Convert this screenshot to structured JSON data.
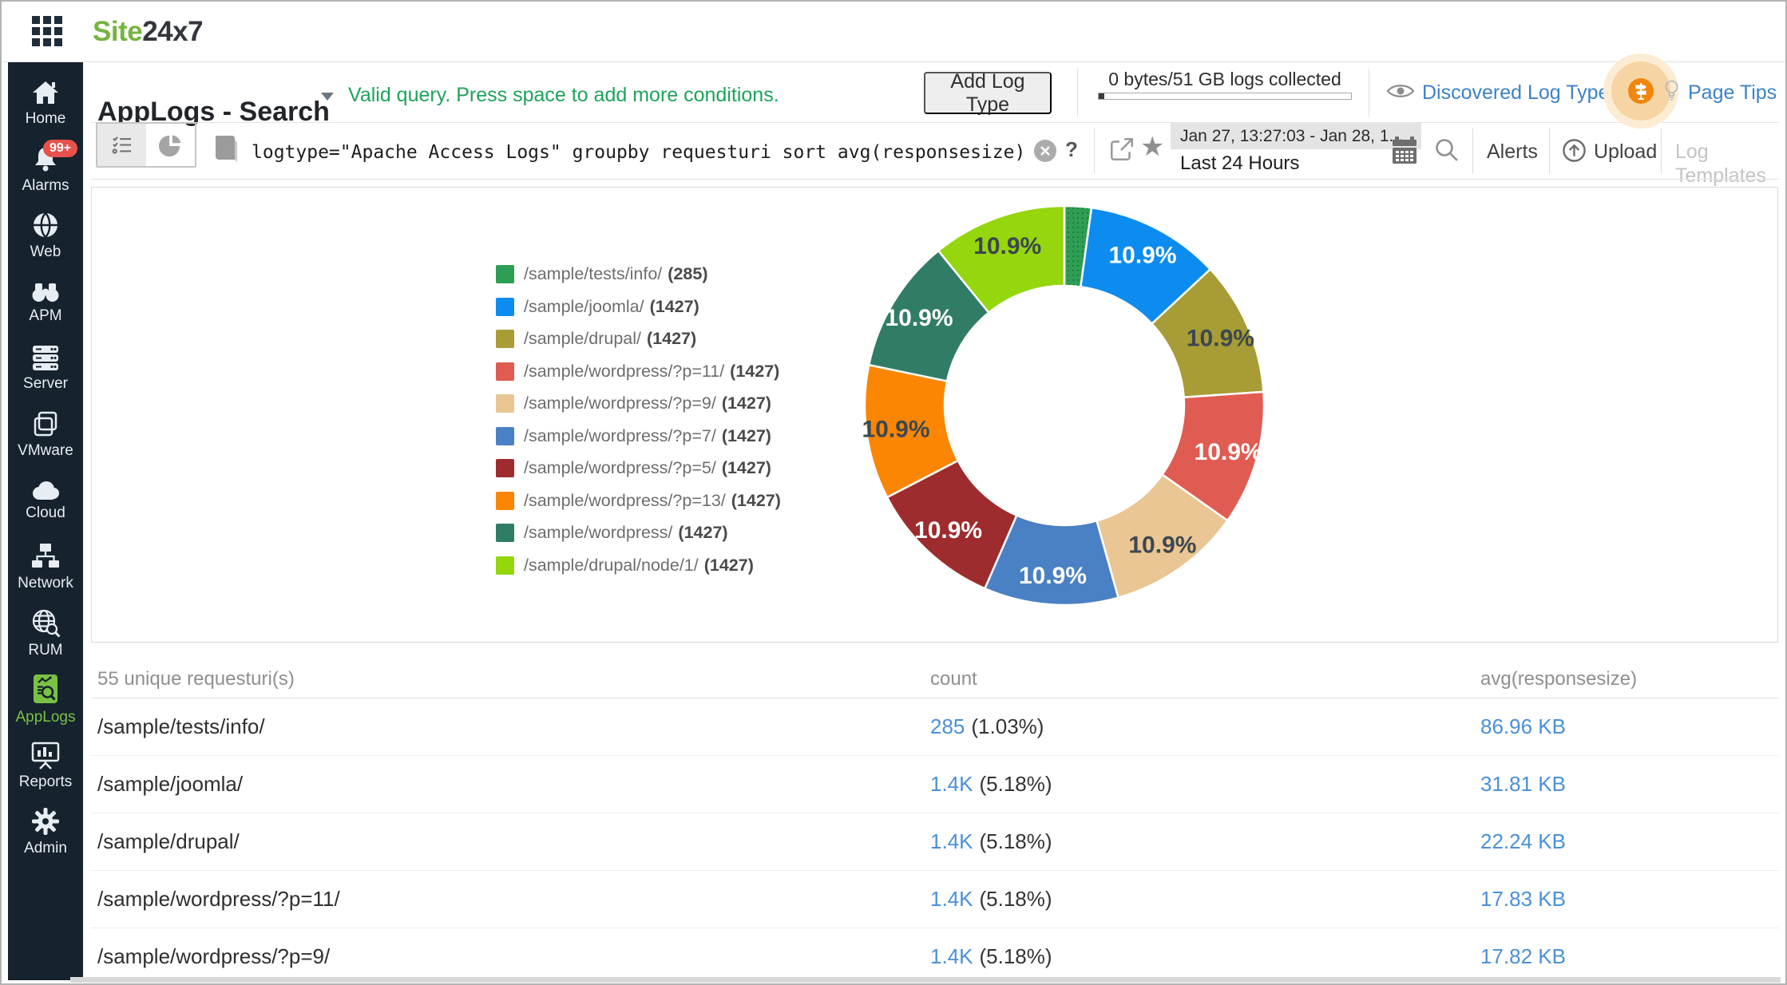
{
  "topbar": {
    "logo_prefix": "Site",
    "logo_suffix": "24x7"
  },
  "sidebar": {
    "items": [
      {
        "label": "Home",
        "icon": "home-icon"
      },
      {
        "label": "Alarms",
        "icon": "bell-icon",
        "badge": "99+"
      },
      {
        "label": "Web",
        "icon": "globe-icon"
      },
      {
        "label": "APM",
        "icon": "binoculars-icon"
      },
      {
        "label": "Server",
        "icon": "server-icon"
      },
      {
        "label": "VMware",
        "icon": "vmware-layers-icon"
      },
      {
        "label": "Cloud",
        "icon": "cloud-icon"
      },
      {
        "label": "Network",
        "icon": "network-icon"
      },
      {
        "label": "RUM",
        "icon": "rum-globe-search-icon"
      },
      {
        "label": "AppLogs",
        "icon": "applogs-icon",
        "active": true
      },
      {
        "label": "Reports",
        "icon": "reports-icon"
      },
      {
        "label": "Admin",
        "icon": "gear-icon"
      }
    ]
  },
  "header": {
    "title": "AppLogs - Search",
    "validation": "Valid query. Press space to add more conditions.",
    "add_log_type": "Add Log Type",
    "quota": "0 bytes/51 GB logs collected",
    "discovered_log_types": "Discovered Log Types",
    "page_tips": "Page Tips"
  },
  "querybar": {
    "query": "logtype=\"Apache Access Logs\" groupby requesturi sort avg(responsesize)",
    "help": "?",
    "star": "★",
    "date_range": "Jan 27, 13:27:03 - Jan 28, 1...",
    "date_preset": "Last 24 Hours",
    "alerts": "Alerts",
    "upload": "Upload",
    "log_templates": "Log Templates"
  },
  "chart_data": {
    "type": "pie",
    "style": "donut",
    "title": "",
    "legend_position": "left",
    "start_angle_deg": -90,
    "direction": "clockwise",
    "labels": [
      "/sample/tests/info/",
      "/sample/joomla/",
      "/sample/drupal/",
      "/sample/wordpress/?p=11/",
      "/sample/wordpress/?p=9/",
      "/sample/wordpress/?p=7/",
      "/sample/wordpress/?p=5/",
      "/sample/wordpress/?p=13/",
      "/sample/wordpress/",
      "/sample/drupal/node/1/"
    ],
    "values": [
      285,
      1427,
      1427,
      1427,
      1427,
      1427,
      1427,
      1427,
      1427,
      1427
    ],
    "colors": [
      "#2f9e55",
      "#0d8cf0",
      "#a79c35",
      "#e05b52",
      "#e9c693",
      "#4a80c4",
      "#9e2b2d",
      "#fb8604",
      "#317c66",
      "#95d60d"
    ],
    "percent_labels": [
      "",
      "10.9%",
      "10.9%",
      "10.9%",
      "10.9%",
      "10.9%",
      "10.9%",
      "10.9%",
      "10.9%",
      "10.9%"
    ],
    "percent_label_colors": [
      "",
      "#ffffff",
      "#3d4750",
      "#ffffff",
      "#3d4750",
      "#ffffff",
      "#ffffff",
      "#3d4750",
      "#ffffff",
      "#3d4750"
    ],
    "legend": [
      {
        "path": "/sample/tests/info/",
        "count": "(285)"
      },
      {
        "path": "/sample/joomla/",
        "count": "(1427)"
      },
      {
        "path": "/sample/drupal/",
        "count": "(1427)"
      },
      {
        "path": "/sample/wordpress/?p=11/",
        "count": "(1427)"
      },
      {
        "path": "/sample/wordpress/?p=9/",
        "count": "(1427)"
      },
      {
        "path": "/sample/wordpress/?p=7/",
        "count": "(1427)"
      },
      {
        "path": "/sample/wordpress/?p=5/",
        "count": "(1427)"
      },
      {
        "path": "/sample/wordpress/?p=13/",
        "count": "(1427)"
      },
      {
        "path": "/sample/wordpress/",
        "count": "(1427)"
      },
      {
        "path": "/sample/drupal/node/1/",
        "count": "(1427)"
      }
    ]
  },
  "table": {
    "rows_summary": "55 unique requesturi(s)",
    "col_count": "count",
    "col_avg": "avg(responsesize)",
    "rows": [
      {
        "uri": "/sample/tests/info/",
        "count": "285",
        "pct": "(1.03%)",
        "avg": "86.96 KB"
      },
      {
        "uri": "/sample/joomla/",
        "count": "1.4K",
        "pct": "(5.18%)",
        "avg": "31.81 KB"
      },
      {
        "uri": "/sample/drupal/",
        "count": "1.4K",
        "pct": "(5.18%)",
        "avg": "22.24 KB"
      },
      {
        "uri": "/sample/wordpress/?p=11/",
        "count": "1.4K",
        "pct": "(5.18%)",
        "avg": "17.83 KB"
      },
      {
        "uri": "/sample/wordpress/?p=9/",
        "count": "1.4K",
        "pct": "(5.18%)",
        "avg": "17.82 KB"
      }
    ]
  }
}
